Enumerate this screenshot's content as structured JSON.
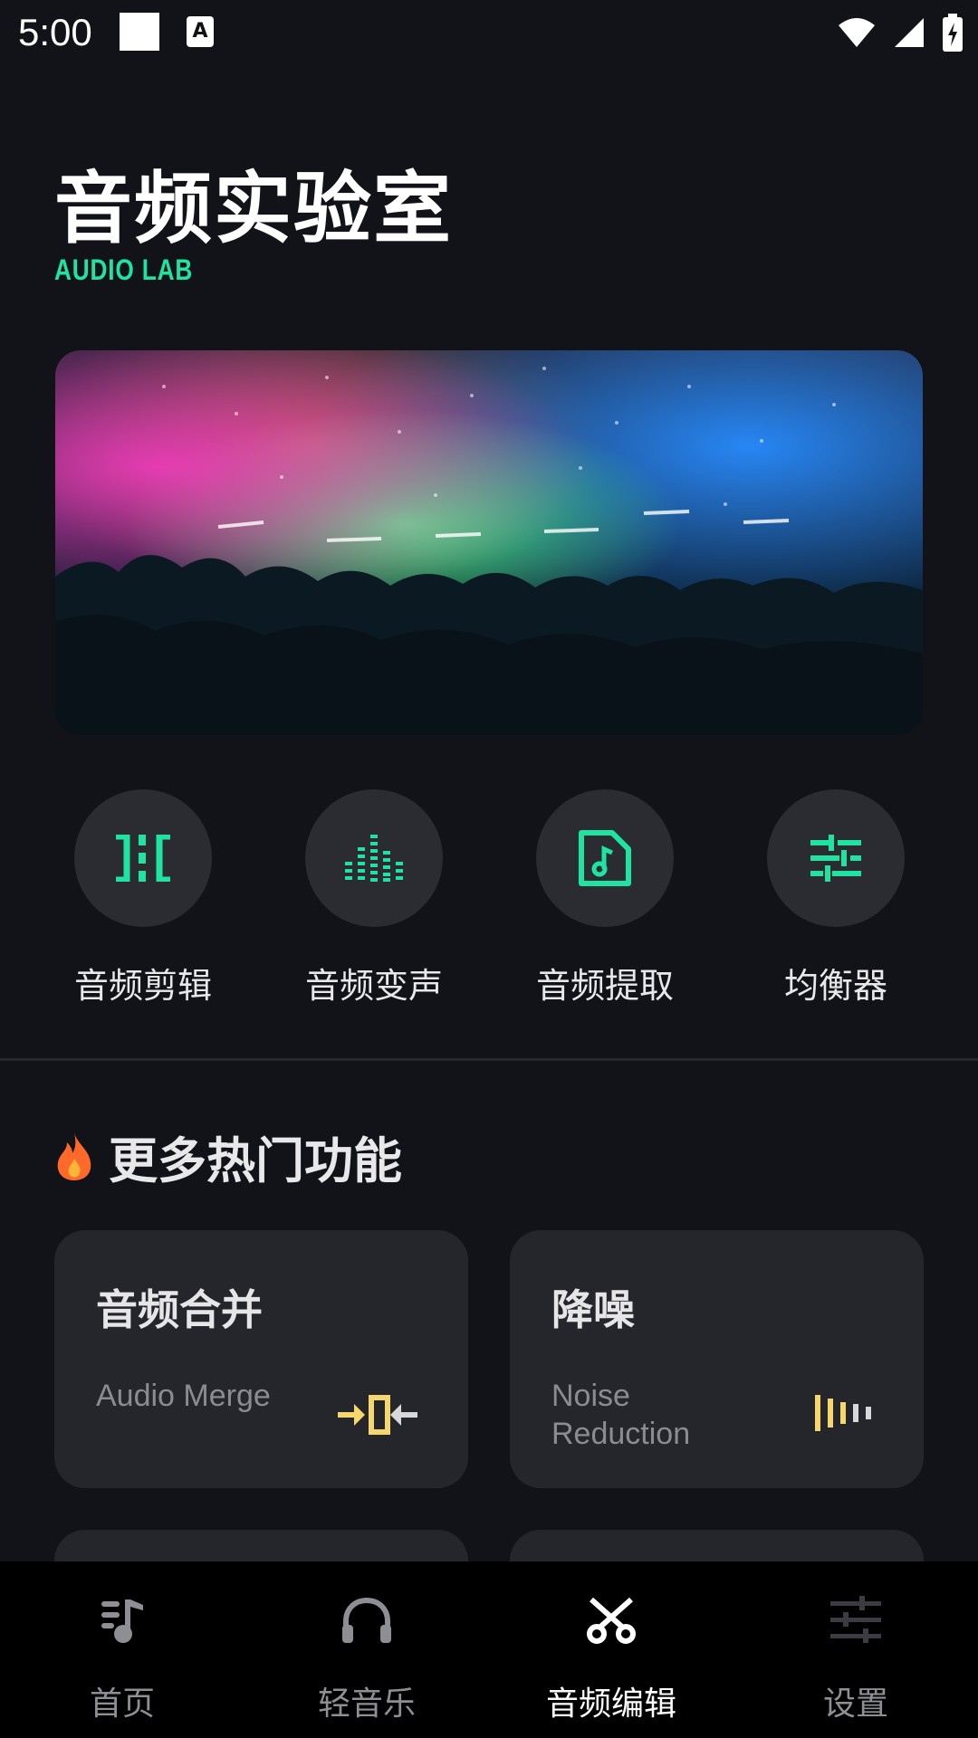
{
  "status_bar": {
    "time": "5:00"
  },
  "header": {
    "title": "音频实验室",
    "subtitle": "AUDIO LAB"
  },
  "banner": {
    "image": "concert-crowd-lights"
  },
  "tools": [
    {
      "label": "音频剪辑",
      "icon": "audio-cut-icon"
    },
    {
      "label": "音频变声",
      "icon": "equalizer-bars-icon"
    },
    {
      "label": "音频提取",
      "icon": "music-file-icon"
    },
    {
      "label": "均衡器",
      "icon": "sliders-icon"
    }
  ],
  "section": {
    "title": "更多热门功能",
    "icon": "fire-icon"
  },
  "cards": [
    {
      "title": "音频合并",
      "subtitle": "Audio Merge",
      "icon": "merge-icon"
    },
    {
      "title": "降噪",
      "subtitle": "Noise Reduction",
      "icon": "noise-bars-icon"
    }
  ],
  "bottom_nav": [
    {
      "label": "首页",
      "icon": "music-note-icon",
      "active": false
    },
    {
      "label": "轻音乐",
      "icon": "headphones-icon",
      "active": false
    },
    {
      "label": "音频编辑",
      "icon": "scissors-icon",
      "active": true
    },
    {
      "label": "设置",
      "icon": "settings-sliders-icon",
      "active": false
    }
  ],
  "colors": {
    "accent": "#20e3a2",
    "background": "#111318",
    "card": "#24262b",
    "icon_yellow": "#f5d76e"
  }
}
